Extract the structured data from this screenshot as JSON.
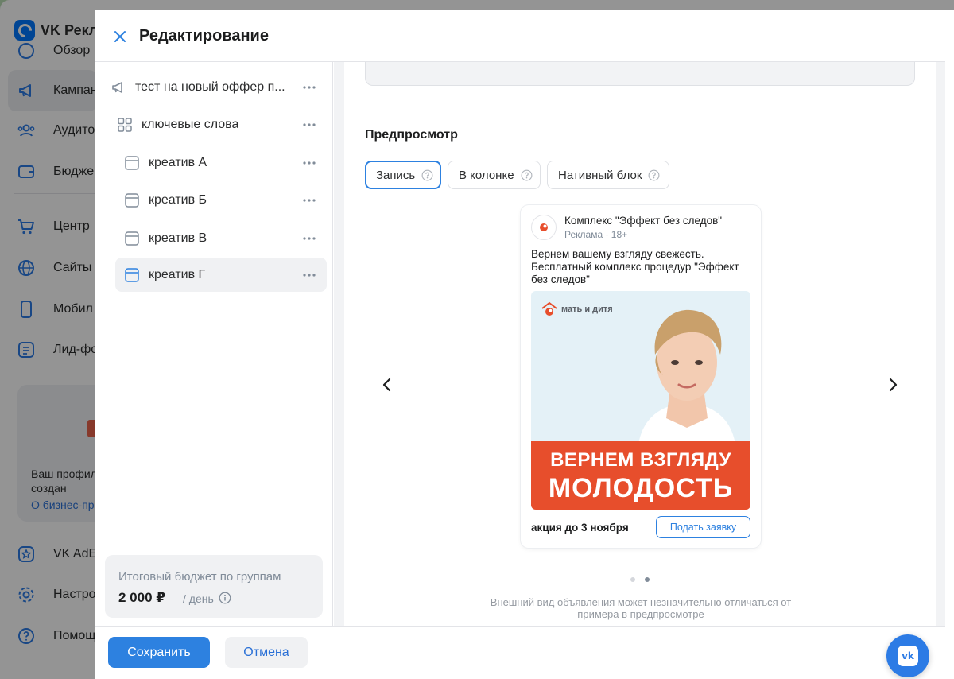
{
  "background_app": {
    "brand": "VK Рекл",
    "nav": [
      {
        "label": "Обзор",
        "icon": "overview-icon",
        "active": false
      },
      {
        "label": "Кампан",
        "icon": "megaphone-icon",
        "active": true
      },
      {
        "label": "Аудито",
        "icon": "audience-icon",
        "active": false
      },
      {
        "label": "Бюдже",
        "icon": "wallet-icon",
        "active": false
      },
      {
        "label": "Центр",
        "icon": "cart-icon",
        "active": false
      },
      {
        "label": "Сайты",
        "icon": "globe-icon",
        "active": false
      },
      {
        "label": "Мобил",
        "icon": "phone-icon",
        "active": false
      },
      {
        "label": "Лид-фо",
        "icon": "list-icon",
        "active": false
      },
      {
        "label": "VK AdE",
        "icon": "star-badge-icon",
        "active": false
      },
      {
        "label": "Настро",
        "icon": "gear-icon",
        "active": false
      },
      {
        "label": "Помощ",
        "icon": "help-icon",
        "active": false
      }
    ],
    "promo": {
      "line1": "Ваш профил",
      "line2": "создан",
      "link": "О бизнес-пр"
    }
  },
  "modal": {
    "title": "Редактирование",
    "tree": [
      {
        "label": "тест на новый оффер п...",
        "icon": "megaphone-icon",
        "level": 0,
        "selected": false
      },
      {
        "label": "ключевые слова",
        "icon": "grid-icon",
        "level": 1,
        "selected": false
      },
      {
        "label": "креатив А",
        "icon": "creative-icon",
        "level": 2,
        "selected": false
      },
      {
        "label": "креатив Б",
        "icon": "creative-icon",
        "level": 2,
        "selected": false
      },
      {
        "label": "креатив В",
        "icon": "creative-icon",
        "level": 2,
        "selected": false
      },
      {
        "label": "креатив Г",
        "icon": "creative-icon",
        "level": 2,
        "selected": true
      }
    ],
    "budget": {
      "title": "Итоговый бюджет по группам",
      "value": "2 000 ₽",
      "unit": "/ день"
    },
    "preview": {
      "title": "Предпросмотр",
      "tabs": [
        {
          "label": "Запись",
          "active": true
        },
        {
          "label": "В колонке",
          "active": false
        },
        {
          "label": "Нативный блок",
          "active": false
        }
      ],
      "ad": {
        "advertiser": "Комплекс \"Эффект без следов\"",
        "meta": "Реклама · 18+",
        "text": "Вернем вашему взгляду свежесть. Бесплатный комплекс процедур \"Эффект без следов\"",
        "image_logo": "мать и дитя",
        "banner_line1": "ВЕРНЕМ ВЗГЛЯДУ",
        "banner_line2": "МОЛОДОСТЬ",
        "footer_text": "акция до 3 ноября",
        "cta": "Подать заявку"
      },
      "pager": {
        "count": 2,
        "active": 2
      },
      "disclaimer": "Внешний вид объявления может незначительно отличаться от примера в предпросмотре"
    },
    "footer": {
      "save": "Сохранить",
      "cancel": "Отмена"
    }
  },
  "colors": {
    "accent": "#2d81e0",
    "banner": "#e74e2c",
    "muted": "#818c99"
  }
}
